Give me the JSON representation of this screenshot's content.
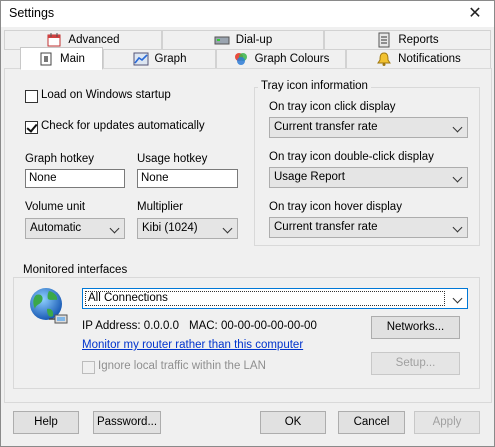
{
  "window": {
    "title": "Settings",
    "close_glyph": "✕"
  },
  "tabs": {
    "row1": [
      {
        "label": "Advanced",
        "icon": "calendar-icon"
      },
      {
        "label": "Dial-up",
        "icon": "modem-icon"
      },
      {
        "label": "Reports",
        "icon": "report-icon"
      }
    ],
    "row2": [
      {
        "label": "Main",
        "icon": "main-icon",
        "selected": true
      },
      {
        "label": "Graph",
        "icon": "graph-icon"
      },
      {
        "label": "Graph Colours",
        "icon": "colours-icon"
      },
      {
        "label": "Notifications",
        "icon": "notifications-icon"
      }
    ]
  },
  "main": {
    "load_on_startup": {
      "label": "Load on Windows startup",
      "checked": false
    },
    "check_updates": {
      "label": "Check for updates automatically",
      "checked": true
    },
    "graph_hotkey": {
      "label": "Graph hotkey",
      "value": "None"
    },
    "usage_hotkey": {
      "label": "Usage hotkey",
      "value": "None"
    },
    "volume_unit": {
      "label": "Volume unit",
      "value": "Automatic"
    },
    "multiplier": {
      "label": "Multiplier",
      "value": "Kibi (1024)"
    }
  },
  "tray": {
    "title": "Tray icon information",
    "click": {
      "label": "On tray icon click display",
      "value": "Current transfer rate"
    },
    "double_click": {
      "label": "On tray icon double-click display",
      "value": "Usage Report"
    },
    "hover": {
      "label": "On tray icon hover display",
      "value": "Current transfer rate"
    }
  },
  "monitored": {
    "title": "Monitored interfaces",
    "interface": "All Connections",
    "ip_address": "IP Address: 0.0.0.0",
    "mac": "MAC: 00-00-00-00-00-00",
    "networks_button": "Networks...",
    "router_link": "Monitor my router rather than this computer",
    "setup_button": "Setup...",
    "ignore_local": {
      "label": "Ignore local traffic within the LAN",
      "checked": false
    }
  },
  "buttons": {
    "help": "Help",
    "password": "Password...",
    "ok": "OK",
    "cancel": "Cancel",
    "apply": "Apply"
  },
  "colors": {
    "accent": "#0078d7",
    "link": "#0033cc"
  }
}
